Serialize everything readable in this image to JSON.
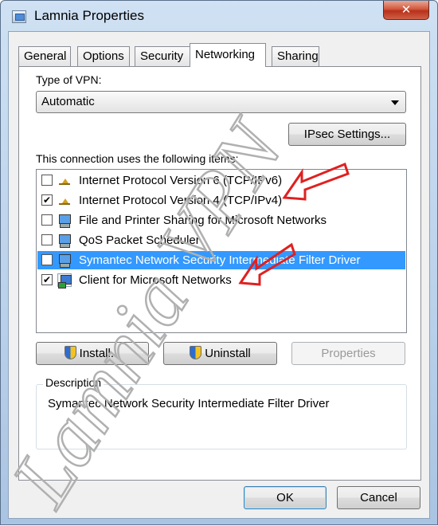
{
  "window": {
    "title": "Lamnia Properties",
    "close_label": "✕"
  },
  "tabs": [
    {
      "label": "General"
    },
    {
      "label": "Options"
    },
    {
      "label": "Security"
    },
    {
      "label": "Networking",
      "active": true
    },
    {
      "label": "Sharing"
    }
  ],
  "networking": {
    "vpn_type_label": "Type of VPN:",
    "vpn_type_value": "Automatic",
    "ipsec_button": "IPsec Settings...",
    "items_label": "This connection uses the following items:",
    "items": [
      {
        "label": "Internet Protocol Version 6 (TCP/IPv6)",
        "checked": false,
        "icon": "protocol-icon",
        "selected": false
      },
      {
        "label": "Internet Protocol Version 4 (TCP/IPv4)",
        "checked": true,
        "icon": "protocol-icon",
        "selected": false
      },
      {
        "label": "File and Printer Sharing for Microsoft Networks",
        "checked": false,
        "icon": "computer-icon",
        "selected": false
      },
      {
        "label": "QoS Packet Scheduler",
        "checked": false,
        "icon": "computer-icon",
        "selected": false
      },
      {
        "label": "Symantec Network Security Intermediate Filter Driver",
        "checked": false,
        "icon": "computer-icon",
        "selected": true
      },
      {
        "label": "Client for Microsoft Networks",
        "checked": true,
        "icon": "client-icon",
        "selected": false
      }
    ],
    "install_button": "Install...",
    "uninstall_button": "Uninstall",
    "properties_button": "Properties",
    "description_title": "Description",
    "description_text": "Symantec Network Security Intermediate Filter Driver"
  },
  "footer": {
    "ok_button": "OK",
    "cancel_button": "Cancel"
  },
  "watermark": {
    "text": "Lamnia VPN",
    "color": "#b0b0b0"
  },
  "colors": {
    "selection": "#3399ff",
    "annotation_arrow": "#e02020"
  }
}
